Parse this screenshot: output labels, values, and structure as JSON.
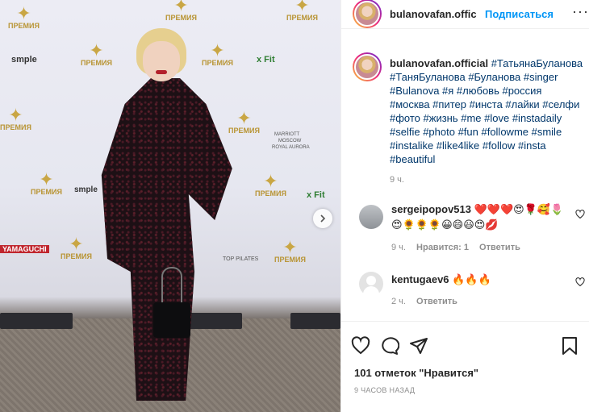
{
  "post": {
    "username": "bulanovafan.official",
    "username_truncated": "bulanovafan.officia",
    "follow_label": "Подписаться",
    "more_label": "···",
    "caption_user": "bulanovafan.official",
    "caption_text": "#ТатьянаБуланова #ТаняБуланова #Буланова #singer #Bulanova #я #любовь #россия #москва #питер #инста #лайки #селфи #фото #жизнь  #me #love #instadaily #selfie #photo #fun #followme #smile #instalike #like4like #follow #insta #beautiful",
    "caption_time": "9 ч.",
    "likes": "101 отметок \"Нравится\"",
    "posted_ago": "9 ЧАСОВ НАЗАД"
  },
  "comments": [
    {
      "user": "sergeipopov513",
      "text": "❤️❤️❤️😍🌹🥰🌷😍🌻🌻🌻😀😄😃😍💋",
      "time": "9 ч.",
      "likes_label": "Нравится: 1",
      "reply_label": "Ответить"
    },
    {
      "user": "kentugaev6",
      "text": "🔥🔥🔥",
      "time": "2 ч.",
      "reply_label": "Ответить"
    }
  ],
  "photo": {
    "wall_texts": [
      "smple",
      "x Fit",
      "MARRIOTT",
      "MOSCOW",
      "ROYAL AURORA",
      "TOP PILATES",
      "YAMAGUCHI",
      "smple",
      "x Fit"
    ],
    "logo_text": "ПРЕМИЯ"
  },
  "icons": {
    "more": "more-horizontal-icon",
    "heart": "heart-outline-icon",
    "comment": "comment-bubble-icon",
    "share": "paper-plane-icon",
    "save": "bookmark-icon",
    "next": "chevron-right-icon"
  },
  "colors": {
    "link_blue": "#0095f6",
    "hashtag": "#00376b",
    "muted": "#8e8e8e"
  }
}
